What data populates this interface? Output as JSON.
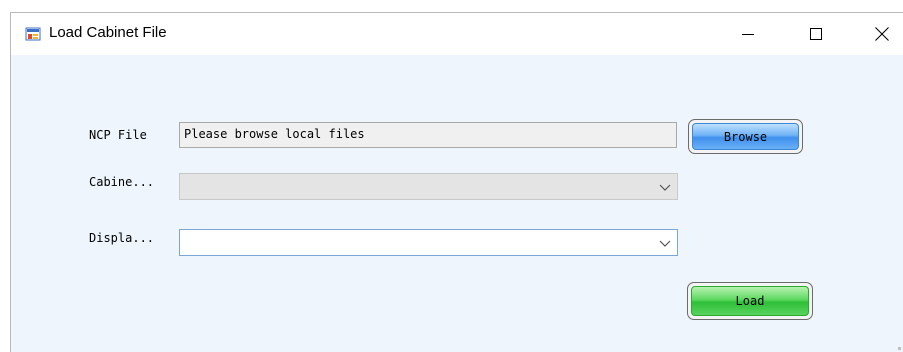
{
  "window": {
    "title": "Load Cabinet File"
  },
  "titlebar_buttons": {
    "minimize_icon": "minimize-icon",
    "maximize_icon": "maximize-icon",
    "close_icon": "close-icon"
  },
  "form": {
    "ncp_file": {
      "label": "NCP File",
      "placeholder": "Please browse local files",
      "browse_label": "Browse"
    },
    "cabinet": {
      "label": "Cabine...",
      "value": ""
    },
    "display": {
      "label": "Displa...",
      "value": ""
    },
    "load_label": "Load"
  },
  "colors": {
    "client_background": "#eef5fd",
    "browse_button": "#4a97ef",
    "load_button": "#38c43f"
  }
}
